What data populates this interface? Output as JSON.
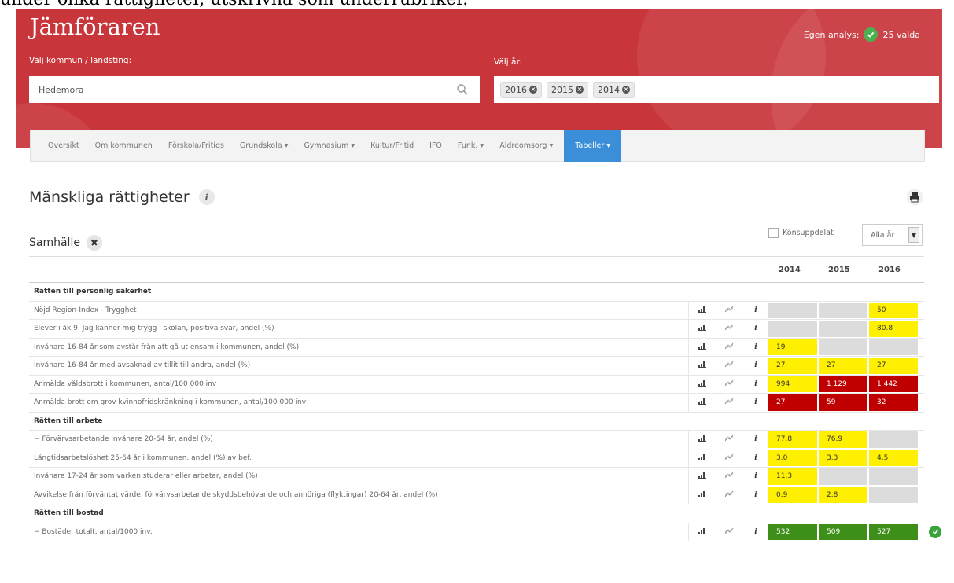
{
  "top_caption": "under olika rättigheter, utskrivna som underrubriker.",
  "app": {
    "title": "Jämföraren",
    "egen_analys_label": "Egen analys:",
    "selected_count": "25 valda"
  },
  "municipality": {
    "label": "Välj kommun / landsting:",
    "value": "Hedemora"
  },
  "years": {
    "label": "Välj år:",
    "tags": [
      "2016",
      "2015",
      "2014"
    ]
  },
  "nav": {
    "items": [
      {
        "label": "Översikt"
      },
      {
        "label": "Om kommunen"
      },
      {
        "label": "Förskola/Fritids"
      },
      {
        "label": "Grundskola ▾"
      },
      {
        "label": "Gymnasium ▾"
      },
      {
        "label": "Kultur/Fritid"
      },
      {
        "label": "IFO"
      },
      {
        "label": "Funk. ▾"
      },
      {
        "label": "Äldreomsorg ▾"
      },
      {
        "label": "Tabeller ▾"
      }
    ]
  },
  "section": {
    "title": "Mänskliga rättigheter",
    "info": "i"
  },
  "subsection": {
    "title": "Samhälle",
    "remove": "✖"
  },
  "controls": {
    "kon_label": "Könsuppdelat",
    "select_value": "Alla år"
  },
  "table": {
    "year_headers": [
      "2014",
      "2015",
      "2016"
    ],
    "rows": [
      {
        "type": "group",
        "label": "Rätten till personlig säkerhet"
      },
      {
        "type": "data",
        "label": "Nöjd Region-Index - Trygghet",
        "cells": [
          {
            "v": "",
            "c": "gray"
          },
          {
            "v": "",
            "c": "gray"
          },
          {
            "v": "50",
            "c": "yellow"
          }
        ]
      },
      {
        "type": "data",
        "label": "Elever i åk 9: Jag känner mig trygg i skolan, positiva svar, andel (%)",
        "cells": [
          {
            "v": "",
            "c": "gray"
          },
          {
            "v": "",
            "c": "gray"
          },
          {
            "v": "80.8",
            "c": "yellow"
          }
        ]
      },
      {
        "type": "data",
        "label": "Invånare 16-84 år som avstår från att gå ut ensam i kommunen, andel (%)",
        "cells": [
          {
            "v": "19",
            "c": "yellow"
          },
          {
            "v": "",
            "c": "gray"
          },
          {
            "v": "",
            "c": "gray"
          }
        ]
      },
      {
        "type": "data",
        "label": "Invånare 16-84 år med avsaknad av tillit till andra, andel (%)",
        "cells": [
          {
            "v": "27",
            "c": "yellow"
          },
          {
            "v": "27",
            "c": "yellow"
          },
          {
            "v": "27",
            "c": "yellow"
          }
        ]
      },
      {
        "type": "data",
        "label": "Anmälda våldsbrott i kommunen, antal/100 000 inv",
        "cells": [
          {
            "v": "994",
            "c": "yellow"
          },
          {
            "v": "1 129",
            "c": "red"
          },
          {
            "v": "1 442",
            "c": "red"
          }
        ]
      },
      {
        "type": "data",
        "label": "Anmälda brott om grov kvinnofridskränkning i kommunen, antal/100 000 inv",
        "cells": [
          {
            "v": "27",
            "c": "red"
          },
          {
            "v": "59",
            "c": "red"
          },
          {
            "v": "32",
            "c": "red"
          }
        ]
      },
      {
        "type": "group",
        "label": "Rätten till arbete"
      },
      {
        "type": "data",
        "label": "− Förvärvsarbetande invånare 20-64 år, andel (%)",
        "cells": [
          {
            "v": "77.8",
            "c": "yellow"
          },
          {
            "v": "76.9",
            "c": "yellow"
          },
          {
            "v": "",
            "c": "gray"
          }
        ]
      },
      {
        "type": "data",
        "label": "Långtidsarbetslöshet 25-64 år i kommunen, andel (%) av bef.",
        "cells": [
          {
            "v": "3.0",
            "c": "yellow"
          },
          {
            "v": "3.3",
            "c": "yellow"
          },
          {
            "v": "4.5",
            "c": "yellow"
          }
        ]
      },
      {
        "type": "data",
        "label": "Invånare 17-24 år som varken studerar eller arbetar, andel (%)",
        "cells": [
          {
            "v": "11.3",
            "c": "yellow"
          },
          {
            "v": "",
            "c": "gray"
          },
          {
            "v": "",
            "c": "gray"
          }
        ]
      },
      {
        "type": "data",
        "label": "Avvikelse från förväntat värde, förvärvsarbetande skyddsbehövande och anhöriga (flyktingar) 20-64 år, andel (%)",
        "cells": [
          {
            "v": "0.9",
            "c": "yellow"
          },
          {
            "v": "2.8",
            "c": "yellow"
          },
          {
            "v": "",
            "c": "gray"
          }
        ]
      },
      {
        "type": "group",
        "label": "Rätten till bostad"
      },
      {
        "type": "data",
        "label": "− Bostäder totalt, antal/1000 inv.",
        "cells": [
          {
            "v": "532",
            "c": "green"
          },
          {
            "v": "509",
            "c": "green"
          },
          {
            "v": "527",
            "c": "green"
          }
        ],
        "check": true
      }
    ]
  }
}
